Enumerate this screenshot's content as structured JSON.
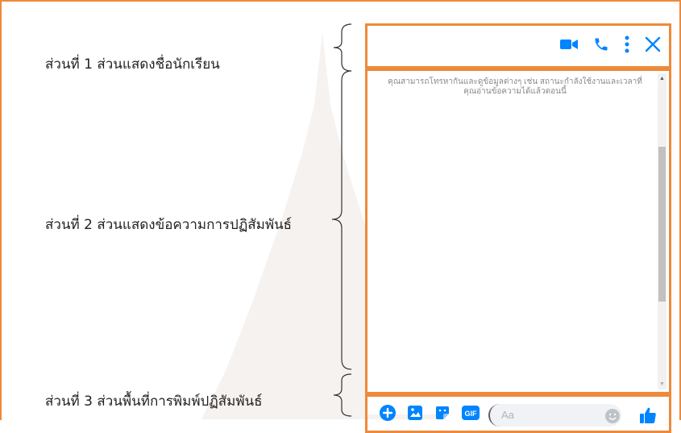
{
  "labels": {
    "section1": "ส่วนที่ 1 ส่วนแสดงชื่อนักเรียน",
    "section2": "ส่วนที่ 2 ส่วนแสดงข้อความการปฏิสัมพันธ์",
    "section3": "ส่วนที่ 3 ส่วนพื้นที่การพิมพ์ปฏิสัมพันธ์"
  },
  "chat": {
    "notice": "คุณสามารถโทรหากันและดูข้อมูลต่างๆ เช่น สถานะกำลังใช้งานและเวลาที่คุณอ่านข้อความได้แล้วตอนนี้",
    "input_placeholder": "Aa",
    "scroll_position": 0.45
  },
  "colors": {
    "accent": "#ee8a3a",
    "messenger_blue": "#0084ff"
  },
  "icons": {
    "header": [
      "video-camera-icon",
      "phone-icon",
      "more-options-icon",
      "close-icon"
    ],
    "composer": [
      "add-plus-icon",
      "photo-icon",
      "sticker-icon",
      "gif-icon",
      "emoji-icon",
      "thumbs-up-icon"
    ]
  }
}
